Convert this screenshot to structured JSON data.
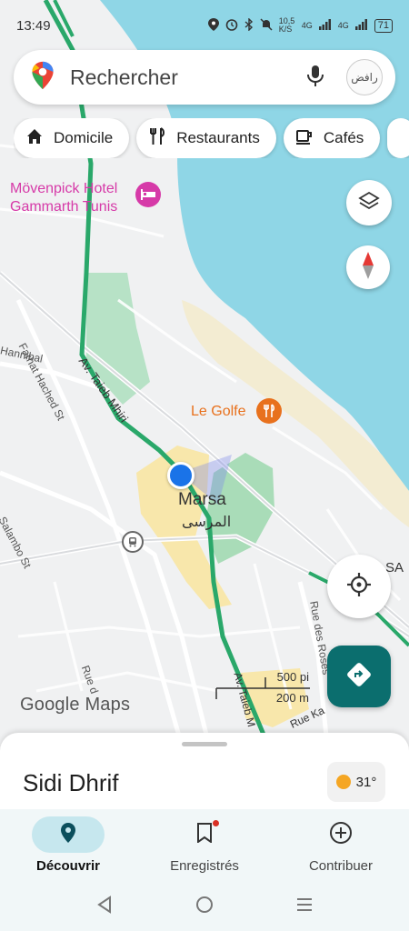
{
  "status_bar": {
    "time": "13:49",
    "net_speed": "10,5 K/S",
    "signal_1": "4G",
    "signal_2": "4G",
    "battery": "71"
  },
  "search": {
    "placeholder": "Rechercher",
    "avatar_text": "رافض"
  },
  "chips": [
    {
      "label": "Domicile",
      "icon": "home-icon"
    },
    {
      "label": "Restaurants",
      "icon": "restaurant-icon"
    },
    {
      "label": "Cafés",
      "icon": "cafe-icon"
    }
  ],
  "map": {
    "poi_hotel_line1": "Mövenpick Hotel",
    "poi_hotel_line2": "Gammarth Tunis",
    "poi_golfe": "Le Golfe",
    "place_marsa": "Marsa",
    "place_marsa_ar": "المرسى",
    "street_farhat": "Farhat Hached St",
    "street_hannibal": "Hannibal",
    "street_taieb": "Av. Taieb Mhiri",
    "street_taieb_2": "Av. Taieb M",
    "street_salambo": "Salambo St",
    "street_roses": "Rue des Roses",
    "street_rue_d": "Rue d",
    "street_rue_ka": "Rue Ka",
    "edge_label": "SA",
    "scale_imperial": "500 pi",
    "scale_metric": "200 m",
    "logo": "Google Maps"
  },
  "sheet": {
    "title": "Sidi Dhrif",
    "temperature": "31°"
  },
  "bottom_nav": [
    {
      "label": "Découvrir",
      "active": true
    },
    {
      "label": "Enregistrés",
      "active": false
    },
    {
      "label": "Contribuer",
      "active": false
    }
  ],
  "colors": {
    "sea": "#8fd6e6",
    "route": "#2aa86a",
    "accent": "#0b6e6e",
    "poi_hotel": "#d63aa8",
    "poi_food": "#e8711d"
  }
}
